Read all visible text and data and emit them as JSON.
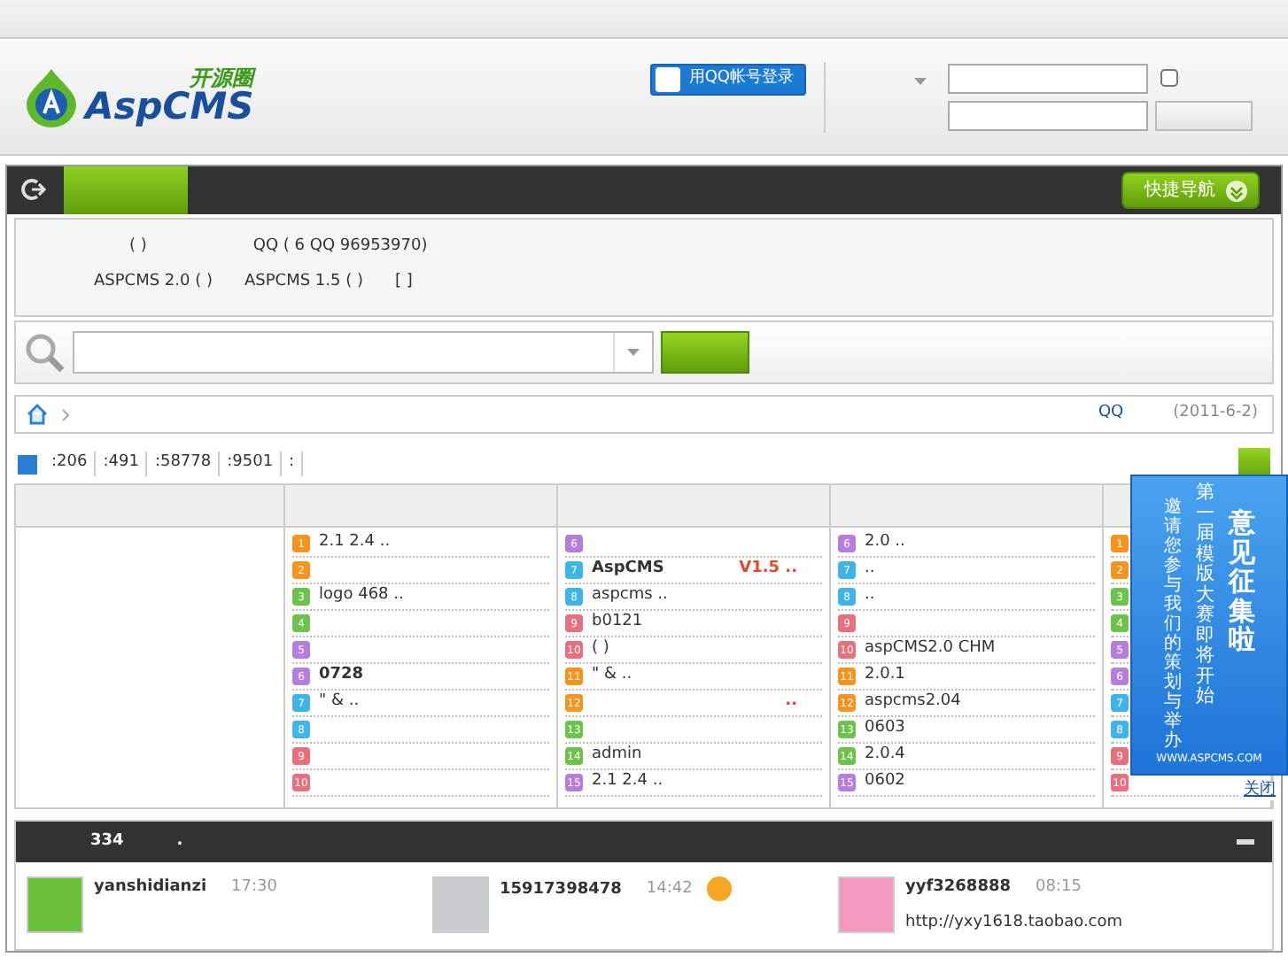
{
  "logo": {
    "subtitle": "开源圈",
    "title": "AspCMS"
  },
  "header": {
    "qq_login": "用QQ帐号登录",
    "remember": {
      "checked": false
    }
  },
  "nav": {
    "tabs": [
      {
        "selected": true
      }
    ],
    "quick_nav": "快捷导航"
  },
  "notice": {
    "lines": [
      [
        "( )",
        "QQ ( 6 QQ 96953970)"
      ],
      [
        "ASPCMS 2.0 ( )",
        "ASPCMS 1.5 ( )",
        "[ ]"
      ]
    ]
  },
  "breadcrumb": {
    "right": "QQ",
    "date": "(2011-6-2)"
  },
  "stats": [
    ":206",
    ":491",
    ":58778",
    ":9501",
    ":"
  ],
  "columns": [
    {
      "items": [
        {
          "num": "1",
          "color": "#f7941d",
          "text": "2.1 2.4 .."
        },
        {
          "num": "2",
          "color": "#f7941d"
        },
        {
          "num": "3",
          "color": "#6cc24a",
          "text": "logo 468 .."
        },
        {
          "num": "4",
          "color": "#6cc24a"
        },
        {
          "num": "5",
          "color": "#b57edc"
        },
        {
          "num": "6",
          "color": "#b57edc",
          "text": "0728",
          "highlight": true
        },
        {
          "num": "7",
          "color": "#3fb4e8",
          "text": "\" & .."
        },
        {
          "num": "8",
          "color": "#3fb4e8"
        },
        {
          "num": "9",
          "color": "#e8707e"
        },
        {
          "num": "10",
          "color": "#e8707e"
        }
      ]
    },
    {
      "items": [
        {
          "num": "6",
          "color": "#b57edc"
        },
        {
          "num": "7",
          "color": "#3fb4e8",
          "text": "AspCMS",
          "suffix": "V1.5 ..",
          "highlight": true
        },
        {
          "num": "8",
          "color": "#3fb4e8",
          "text": "aspcms .."
        },
        {
          "num": "9",
          "color": "#e8707e",
          "text": "b0121"
        },
        {
          "num": "10",
          "color": "#e8707e",
          "text": "( )"
        },
        {
          "num": "11",
          "color": "#f7941d",
          "text": "\" & .."
        },
        {
          "num": "12",
          "color": "#f7941d",
          "suffix": ".."
        },
        {
          "num": "13",
          "color": "#6cc24a"
        },
        {
          "num": "14",
          "color": "#6cc24a",
          "text": "admin"
        },
        {
          "num": "15",
          "color": "#b57edc",
          "text": "2.1 2.4 .."
        }
      ]
    },
    {
      "items": [
        {
          "num": "6",
          "color": "#b57edc",
          "text": "2.0 .."
        },
        {
          "num": "7",
          "color": "#3fb4e8",
          "text": ".."
        },
        {
          "num": "8",
          "color": "#3fb4e8",
          "text": ".."
        },
        {
          "num": "9",
          "color": "#e8707e"
        },
        {
          "num": "10",
          "color": "#e8707e",
          "text": "aspCMS2.0 CHM"
        },
        {
          "num": "11",
          "color": "#f7941d",
          "text": "2.0.1"
        },
        {
          "num": "12",
          "color": "#f7941d",
          "text": "aspcms2.04"
        },
        {
          "num": "13",
          "color": "#6cc24a",
          "text": "0603"
        },
        {
          "num": "14",
          "color": "#6cc24a",
          "text": "2.0.4"
        },
        {
          "num": "15",
          "color": "#b57edc",
          "text": "0602"
        }
      ]
    },
    {
      "items": [
        {
          "num": "1",
          "color": "#f7941d"
        },
        {
          "num": "2",
          "color": "#f7941d"
        },
        {
          "num": "3",
          "color": "#6cc24a"
        },
        {
          "num": "4",
          "color": "#6cc24a"
        },
        {
          "num": "5",
          "color": "#b57edc"
        },
        {
          "num": "6",
          "color": "#b57edc"
        },
        {
          "num": "7",
          "color": "#3fb4e8"
        },
        {
          "num": "8",
          "color": "#3fb4e8"
        },
        {
          "num": "9",
          "color": "#e8707e"
        },
        {
          "num": "10",
          "color": "#e8707e"
        }
      ]
    }
  ],
  "ad": {
    "headline": "意见征集啦",
    "line1": "第一届模版大赛即将开始",
    "line2": "邀请您参与我们的策划与举办",
    "site": "WWW.ASPCMS.COM",
    "close": "关闭"
  },
  "feed": {
    "title": "334",
    "suffix": ".",
    "posts": [
      {
        "user": "yanshidianzi",
        "time": "17:30"
      },
      {
        "user": "15917398478",
        "time": "14:42",
        "emoji": true
      },
      {
        "user": "yyf3268888",
        "time": "08:15",
        "text": "http://yxy1618.taobao.com"
      }
    ]
  }
}
